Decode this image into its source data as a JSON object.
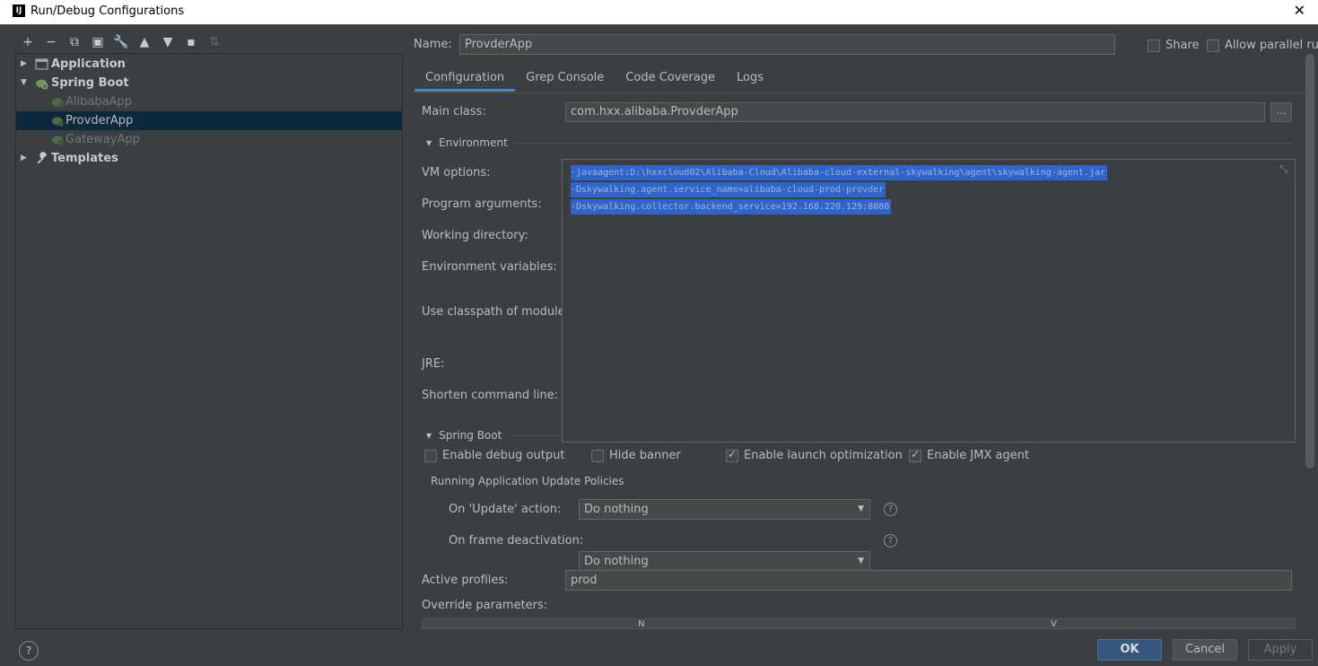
{
  "window": {
    "title": "Run/Debug Configurations",
    "logo": "IJ",
    "close": "✕"
  },
  "toolbar": {
    "add": "+",
    "remove": "−",
    "copy": "⧉",
    "save": "▣",
    "wrench": "🔧",
    "up": "▲",
    "down": "▼",
    "folder": "▪",
    "sort": "⇅"
  },
  "tree": {
    "application": "Application",
    "spring_boot": "Spring Boot",
    "children": [
      "AlibabaApp",
      "ProvderApp",
      "GatewayApp"
    ],
    "templates": "Templates"
  },
  "header": {
    "name_label": "Name:",
    "name_value": "ProvderApp",
    "share": "Share",
    "allow_parallel": "Allow parallel run"
  },
  "tabs": [
    "Configuration",
    "Grep Console",
    "Code Coverage",
    "Logs"
  ],
  "config": {
    "main_class_label": "Main class:",
    "main_class_value": "com.hxx.alibaba.ProvderApp",
    "browse": "...",
    "environment": "Environment",
    "vm_options_label": "VM options:",
    "program_args_label": "Program arguments:",
    "working_dir_label": "Working directory:",
    "env_vars_label": "Environment variables:",
    "classpath_label": "Use classpath of module:",
    "jre_label": "JRE:",
    "shorten_label": "Shorten command line:",
    "vm_lines": [
      "-javaagent:D:\\hxxcloud02\\Alibaba-Cloud\\Alibaba-cloud-external-skywalking\\agent\\skywalking-agent.jar",
      "-Dskywalking.agent.service_name=alibaba-cloud-prod-provder",
      "-Dskywalking.collector.backend_service=192.168.220.129:8080"
    ],
    "expand": "⤡"
  },
  "spring_boot": {
    "section": "Spring Boot",
    "enable_debug": "Enable debug output",
    "hide_banner": "Hide banner",
    "launch_opt": "Enable launch optimization",
    "jmx": "Enable JMX agent",
    "policies": "Running Application Update Policies",
    "on_update_label": "On 'Update' action:",
    "on_update_value": "Do nothing",
    "on_frame_label": "On frame deactivation:",
    "on_frame_value": "Do nothing",
    "active_profiles_label": "Active profiles:",
    "active_profiles_value": "prod",
    "override_label": "Override parameters:",
    "col_name": "N",
    "col_value": "V"
  },
  "buttons": {
    "ok": "OK",
    "cancel": "Cancel",
    "apply": "Apply",
    "help": "?"
  },
  "colors": {
    "background": "#3c3f41",
    "selection": "#0d293e",
    "accent": "#4a88c7",
    "ok": "#365880",
    "highlight": "#2f65ca"
  }
}
